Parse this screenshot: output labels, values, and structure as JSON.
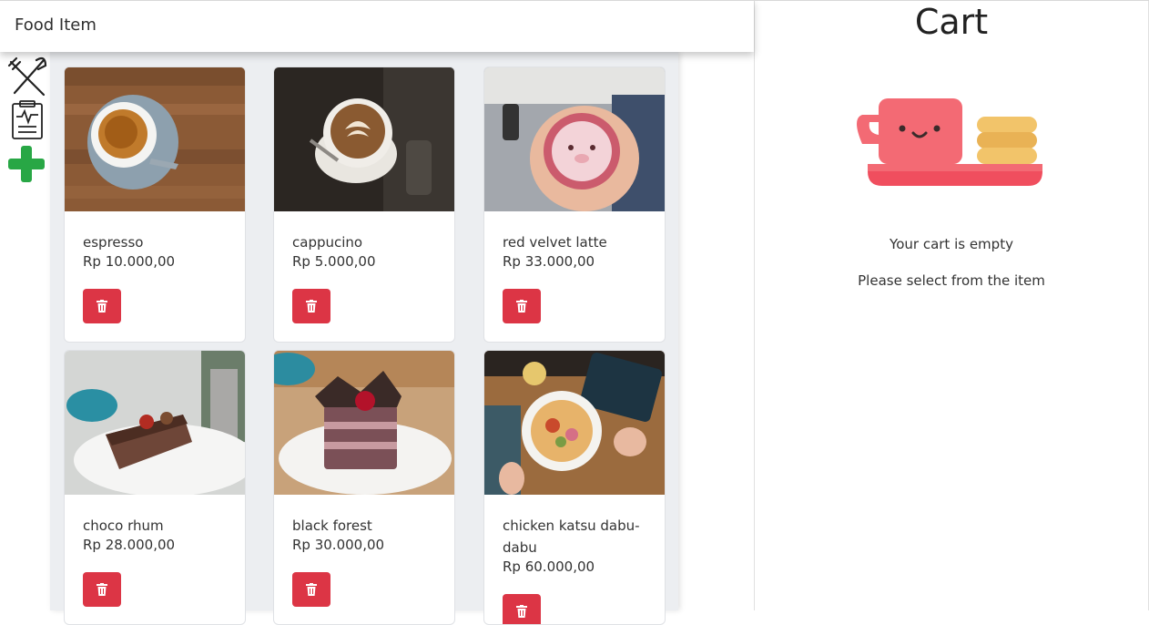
{
  "header": {
    "title": "Food Item"
  },
  "sidebar": {
    "icons": [
      "utensils-icon",
      "clipboard-report-icon",
      "add-icon"
    ]
  },
  "items": [
    {
      "name": "espresso",
      "price": "Rp 10.000,00"
    },
    {
      "name": "cappucino",
      "price": "Rp 5.000,00"
    },
    {
      "name": "red velvet latte",
      "price": "Rp 33.000,00"
    },
    {
      "name": "choco rhum",
      "price": "Rp 28.000,00"
    },
    {
      "name": "black forest",
      "price": "Rp 30.000,00"
    },
    {
      "name": "chicken katsu dabu-dabu",
      "price": "Rp 60.000,00"
    }
  ],
  "cart": {
    "title": "Cart",
    "empty_message": "Your cart is empty",
    "hint": "Please select from the item"
  },
  "colors": {
    "delete": "#dc3545",
    "add": "#28a745"
  }
}
